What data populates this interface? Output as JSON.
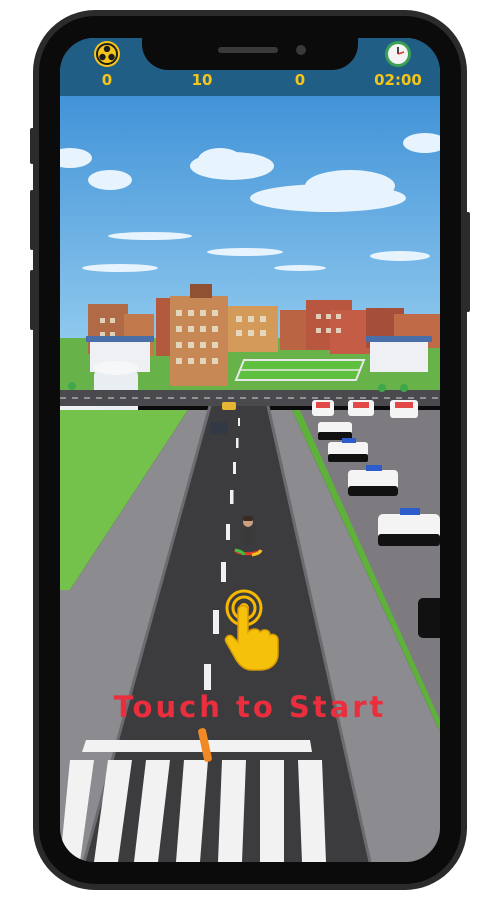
{
  "hud": {
    "biohazard_count": "0",
    "score": "10",
    "count": "0",
    "timer": "02:00",
    "left_icon": "biohazard-icon",
    "right_icon": "clock-icon"
  },
  "prompt": {
    "text": "Touch to Start",
    "hand_icon": "tap-hand-icon"
  },
  "colors": {
    "hud_bar": "#215e86",
    "hud_text": "#f5c518",
    "prompt_text": "#ea2e3e",
    "sky": "#3f93d6",
    "grass": "#74c24c",
    "road": "#3c3c3f"
  }
}
